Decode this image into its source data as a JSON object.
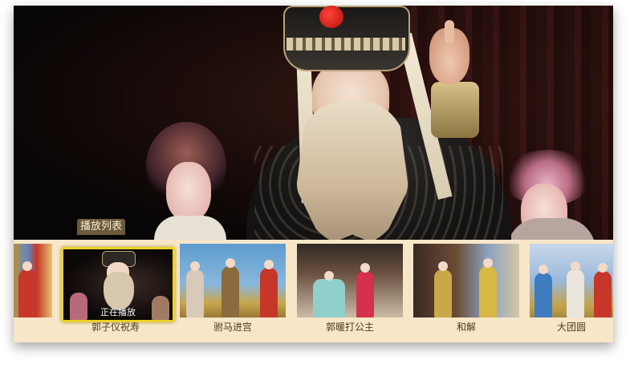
{
  "playlist": {
    "label": "播放列表",
    "now_playing_label": "正在播放",
    "items": [
      {
        "title": ""
      },
      {
        "title": "郭子仪祝寿",
        "active": true
      },
      {
        "title": "驸马进宫"
      },
      {
        "title": "郭暖打公主"
      },
      {
        "title": "和解"
      },
      {
        "title": "大团圆"
      }
    ]
  },
  "colors": {
    "strip_background": "#f7e6c8",
    "active_border": "#ecd22a",
    "tag_background": "#6c5a3b",
    "caption_text": "#4e3b22"
  }
}
